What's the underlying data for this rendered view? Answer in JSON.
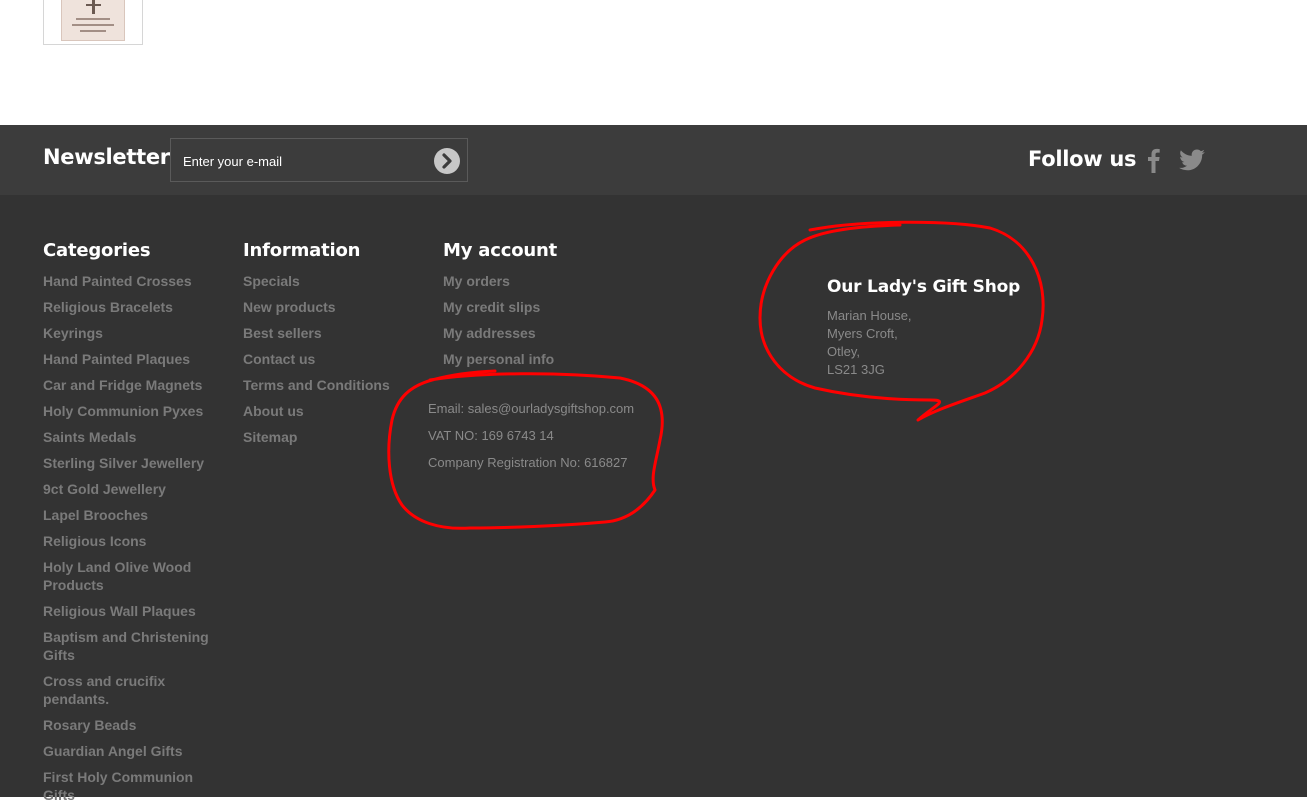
{
  "newsletter": {
    "title": "Newsletter",
    "placeholder": "Enter your e-mail"
  },
  "follow": {
    "title": "Follow us",
    "icons": [
      "facebook-icon",
      "twitter-icon"
    ]
  },
  "categories": {
    "title": "Categories",
    "items": [
      "Hand Painted Crosses",
      "Religious Bracelets",
      "Keyrings",
      "Hand Painted Plaques",
      "Car and Fridge Magnets",
      "Holy Communion Pyxes",
      "Saints Medals",
      "Sterling Silver Jewellery",
      "9ct Gold Jewellery",
      "Lapel Brooches",
      "Religious Icons",
      "Holy Land Olive Wood Products",
      "Religious Wall Plaques",
      "Baptism and Christening Gifts",
      "Cross and crucifix pendants.",
      "Rosary Beads",
      "Guardian Angel Gifts",
      "First Holy Communion Gifts"
    ]
  },
  "information": {
    "title": "Information",
    "items": [
      "Specials",
      "New products",
      "Best sellers",
      "Contact us",
      "Terms and Conditions",
      "About us",
      "Sitemap"
    ]
  },
  "account": {
    "title": "My account",
    "items": [
      "My orders",
      "My credit slips",
      "My addresses",
      "My personal info"
    ]
  },
  "contact": {
    "email": "Email: sales@ourladysgiftshop.com",
    "vat": "VAT NO: 169 6743 14",
    "company": "Company Registration No: 616827"
  },
  "shop": {
    "name": "Our Lady's Gift Shop",
    "address": [
      "Marian House,",
      "Myers Croft,",
      "Otley,",
      "LS21 3JG"
    ]
  },
  "colors": {
    "newsbar_bg": "#3c3c3c",
    "footer_bg": "#333333",
    "link": "#7a7a7a",
    "annotation": "#ff0000"
  }
}
